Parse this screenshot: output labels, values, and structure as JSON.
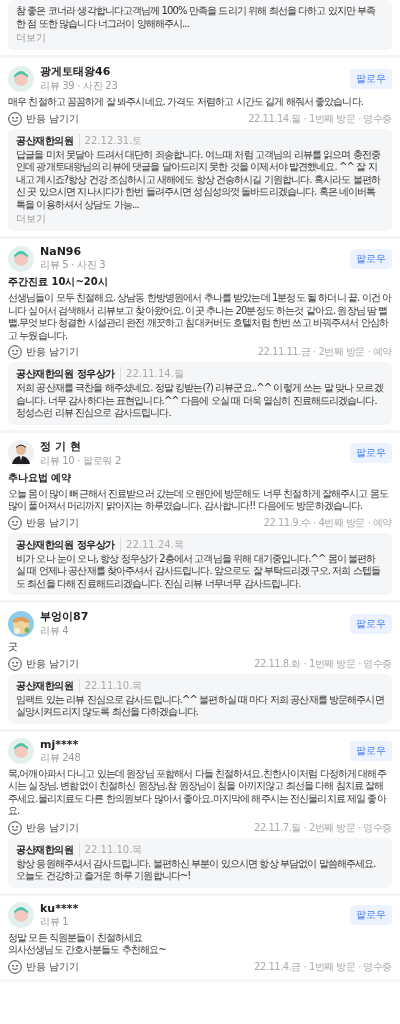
{
  "top_reply": {
    "text": "참 좋은 코너라 생각합니다고객님께 100% 만족을 드리기 위해 최선을 다하고 있지만 부족한 점 또한 많습니다 너그러이 양해해주시...",
    "more": "더보기"
  },
  "reviews": [
    {
      "avatar": {
        "kind": "default"
      },
      "name": "광게토태왕46",
      "stats": "리뷰 39 · 사진 23",
      "follow": "팔로우",
      "body": "매우 친절하고 꼼꼼하게 잘 봐주시네요. 가격도 저렴하고 시간도 길게 해줘서 좋았습니다.",
      "react": "반응 남기기",
      "meta": "22.11.14.월 · 1번째 방문 · 영수증",
      "reply": {
        "author": "공산재한의원",
        "date": "22.12.31.토",
        "text": "답글을 미처 못달아 드려서 대단히 죄송합니다. 여느때 처럼 고객님의 리뷰를 읽으며 충전중인데 광개토태왕님의 리뷰에 댓글을 달아드리지 못한 것을 이제서야 발견했네요. ^^ 잘 지내고 계시죠?항상 건강 조심하시고 새해에도 항상 건승하시길 기원합니다. 혹시라도 불편하신 곳 있으시면 지나시다가 한번 들려주시면 성심성의껏 돌바드리겠습니다. 혹은 네이버톡톡을 이용하셔서 상담도 가능...",
        "more": "더보기"
      }
    },
    {
      "avatar": {
        "kind": "default"
      },
      "name": "NaN96",
      "stats": "리뷰 5 · 사진 3",
      "follow": "팔로우",
      "title": "주간진료 10시~20시",
      "body": "선생님들이 모두 친절해요. 상남동 한방병원에서 추나를 받았는데 1분정도 될 하더니 끝. 이건 아니다 싶어서 검색해서 리뷰보고 찾아왔어요. 이곳 추나는 20분정도 하는것 같아요. 원장님 땀 뻘뻘.무엇보다 청결한 시설관리 완전 깨끗하고 침대커버도 호텔처럼 한번 쓰고 바꿔주셔서 안심하고 누웠습니다.",
      "react": "반응 남기기",
      "meta": "22.11.11.금 · 2번째 방문 · 예약",
      "reply": {
        "author": "공산재한의원 정우상가",
        "date": "22.11.14.월",
        "text": "저희 공산재를 극찬을 해주셨네요. 정말 킹받는(?) 리뷰군요..^^ 이렇게 쓰는 말 맞나 모르겠습니다. 너무 감사하다는 표현입니다.^^ 다음에 오실 때 더욱 열심히 진료해드리겠습니다. 정성스런 리뷰 진심으로 감사드립니다."
      }
    },
    {
      "name": "정 기 현",
      "stats": "리뷰 10 · 팔로워 2",
      "follow": "팔로우",
      "title": "추나요법 예약",
      "body": "오늘 몸이 많이 뻐근해서 진료받으러 갔는데 오랜만에 방문해도 너무 친절하게 잘해주시고 몸도많이 풀어져서 머리까지 맑아지는 하루였습니다. 감사합니다!! 다음에도 방문하겠습니다.",
      "react": "반응 남기기",
      "meta": "22.11.9.수 · 4번째 방문 · 예약",
      "reply": {
        "author": "공산재한의원 정우상가",
        "date": "22.11.24.목",
        "text": "비가 오나 눈이 오나, 항상 정우상가 2층에서 고객님을 위해 대기중입니다.^^ 몸이 불편하실 때 언제나 공산재를 찾아주셔서 감사드립니다. 앞으로도 잘 부탁드리겠구오. 저희 스텝들도 최선을 다해 진료해드리겠습니다. 진심 리뷰 너무너무 감사드립니다."
      }
    },
    {
      "avatar": {
        "kind": "drawing"
      },
      "name": "부엉이87",
      "stats": "리뷰 4",
      "follow": "팔로우",
      "body": "굿",
      "react": "반응 남기기",
      "meta": "22.11.8.화 · 1번째 방문 · 영수증",
      "reply": {
        "author": "공산재한의원",
        "date": "22.11.10.목",
        "text": "임팩트 있는 리뷰 진심으로 감사드립니다.^^ 불편하실 때 마다 저희 공산재를 방문해주시면 실망시켜드리지 않도록 최선을 다하겠습니다."
      }
    },
    {
      "avatar": {
        "kind": "default"
      },
      "name": "mj****",
      "stats": "리뷰 248",
      "follow": "팔로우",
      "body": "목,어깨아파서 다니고 있는데 원장님 포함해서 다들 친절하셔요.친한사이처럼 다정하게 대해주시는 실장님. 변함없이 친절하신 원장님.참 원장님이 침을 아끼지않고 최선을 다해 침치료 잘해주세요.물리치료도 다른 한의원보다 많아서 좋아요.마지막에 해주시는 전신물리치료 제일 좋아요.",
      "react": "반응 남기기",
      "meta": "22.11.7.월 · 2번째 방문 · 영수증",
      "reply": {
        "author": "공산재한의원",
        "date": "22.11.10.목",
        "text": "항상 응원해주셔서 감사드립니다. 불편하신 부분이 있으시면 항상 부담없이 말씀해주세요. 오늘도 건강하고 즐거운 하루 기원합니다~!"
      }
    },
    {
      "avatar": {
        "kind": "default"
      },
      "name": "ku****",
      "stats": "리뷰 1",
      "follow": "팔로우",
      "body": "정말 모든 직원분들이 친절하세요\n의사선생님도 간호사분들도 추천해요~",
      "react": "반응 남기기",
      "meta": "22.11.4.금 · 1번째 방문 · 영수증"
    }
  ]
}
